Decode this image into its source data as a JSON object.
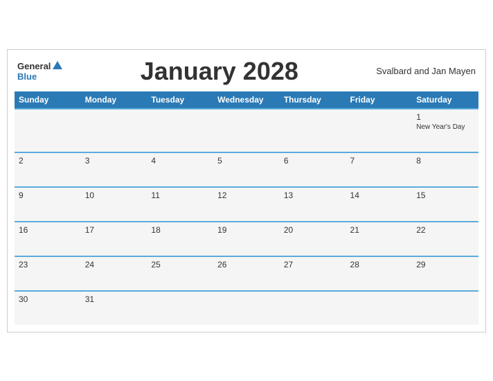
{
  "header": {
    "logo_general": "General",
    "logo_blue": "Blue",
    "title": "January 2028",
    "region": "Svalbard and Jan Mayen"
  },
  "days_of_week": [
    "Sunday",
    "Monday",
    "Tuesday",
    "Wednesday",
    "Thursday",
    "Friday",
    "Saturday"
  ],
  "weeks": [
    [
      {
        "day": "",
        "holiday": ""
      },
      {
        "day": "",
        "holiday": ""
      },
      {
        "day": "",
        "holiday": ""
      },
      {
        "day": "",
        "holiday": ""
      },
      {
        "day": "",
        "holiday": ""
      },
      {
        "day": "",
        "holiday": ""
      },
      {
        "day": "1",
        "holiday": "New Year's Day"
      }
    ],
    [
      {
        "day": "2",
        "holiday": ""
      },
      {
        "day": "3",
        "holiday": ""
      },
      {
        "day": "4",
        "holiday": ""
      },
      {
        "day": "5",
        "holiday": ""
      },
      {
        "day": "6",
        "holiday": ""
      },
      {
        "day": "7",
        "holiday": ""
      },
      {
        "day": "8",
        "holiday": ""
      }
    ],
    [
      {
        "day": "9",
        "holiday": ""
      },
      {
        "day": "10",
        "holiday": ""
      },
      {
        "day": "11",
        "holiday": ""
      },
      {
        "day": "12",
        "holiday": ""
      },
      {
        "day": "13",
        "holiday": ""
      },
      {
        "day": "14",
        "holiday": ""
      },
      {
        "day": "15",
        "holiday": ""
      }
    ],
    [
      {
        "day": "16",
        "holiday": ""
      },
      {
        "day": "17",
        "holiday": ""
      },
      {
        "day": "18",
        "holiday": ""
      },
      {
        "day": "19",
        "holiday": ""
      },
      {
        "day": "20",
        "holiday": ""
      },
      {
        "day": "21",
        "holiday": ""
      },
      {
        "day": "22",
        "holiday": ""
      }
    ],
    [
      {
        "day": "23",
        "holiday": ""
      },
      {
        "day": "24",
        "holiday": ""
      },
      {
        "day": "25",
        "holiday": ""
      },
      {
        "day": "26",
        "holiday": ""
      },
      {
        "day": "27",
        "holiday": ""
      },
      {
        "day": "28",
        "holiday": ""
      },
      {
        "day": "29",
        "holiday": ""
      }
    ],
    [
      {
        "day": "30",
        "holiday": ""
      },
      {
        "day": "31",
        "holiday": ""
      },
      {
        "day": "",
        "holiday": ""
      },
      {
        "day": "",
        "holiday": ""
      },
      {
        "day": "",
        "holiday": ""
      },
      {
        "day": "",
        "holiday": ""
      },
      {
        "day": "",
        "holiday": ""
      }
    ]
  ]
}
